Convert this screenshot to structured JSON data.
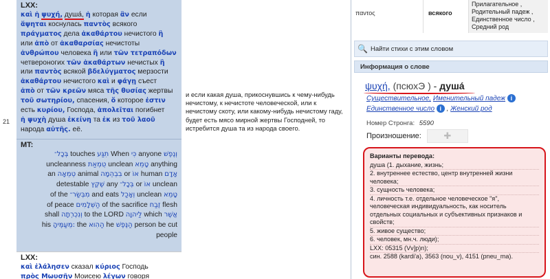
{
  "verse_number": "21",
  "lxx": {
    "label": "LXX:",
    "lines": [
      [
        {
          "g": "καὶ ἡ"
        },
        {
          "g": "ψυχή,",
          "u": true
        },
        {
          "r": "душа́,",
          "u": true
        },
        {
          "g": "ἡ"
        },
        {
          "r": "которая"
        },
        {
          "g": "ἂν"
        },
        {
          "r": "если"
        }
      ],
      [
        {
          "g": "ἅψηται"
        },
        {
          "r": "коснулась"
        },
        {
          "g": "παντὸς"
        },
        {
          "r": "всякого"
        }
      ],
      [
        {
          "g": "πράγματος"
        },
        {
          "r": "дела"
        },
        {
          "g": "ἀκαθάρτου"
        },
        {
          "r": "нечистого"
        },
        {
          "g": "ἢ"
        }
      ],
      [
        {
          "r": "или"
        },
        {
          "g": "ἀπὸ"
        },
        {
          "r": "от"
        },
        {
          "g": "ἀκαθαρσίας"
        },
        {
          "r": "нечистоты"
        }
      ],
      [
        {
          "g": "ἀνθρώπου"
        },
        {
          "r": "человека"
        },
        {
          "g": "ἢ"
        },
        {
          "r": "или"
        },
        {
          "g": "τῶν τετραπόδων"
        }
      ],
      [
        {
          "r": "четвероногих"
        },
        {
          "g": "τῶν ἀκαθάρτων"
        },
        {
          "r": "нечистых"
        },
        {
          "g": "ἢ"
        }
      ],
      [
        {
          "r": "или"
        },
        {
          "g": "παντὸς"
        },
        {
          "r": "всякой"
        },
        {
          "g": "βδελύγματος"
        },
        {
          "r": "мерзости"
        }
      ],
      [
        {
          "g": "ἀκαθάρτου"
        },
        {
          "r": "нечистого"
        },
        {
          "g": "καὶ"
        },
        {
          "r": "и"
        },
        {
          "g": "φάγῃ"
        },
        {
          "r": "съест"
        }
      ],
      [
        {
          "g": "ἀπὸ"
        },
        {
          "r": "от"
        },
        {
          "g": "τῶν κρεῶν"
        },
        {
          "r": "мяса"
        },
        {
          "g": "τῆς θυσίας"
        },
        {
          "r": "жертвы"
        }
      ],
      [
        {
          "g": "τοῦ σωτηρίου,"
        },
        {
          "r": "спасения,"
        },
        {
          "g": "ὅ"
        },
        {
          "r": "которое"
        },
        {
          "g": "ἐστιν"
        }
      ],
      [
        {
          "r": "есть"
        },
        {
          "g": "κυρίου,"
        },
        {
          "r": "Господа,"
        },
        {
          "g": "ἀπολεῖται"
        },
        {
          "r": "погибнет"
        }
      ],
      [
        {
          "g": "ἡ ψυχὴ"
        },
        {
          "r": "душа"
        },
        {
          "g": "ἐκείνη"
        },
        {
          "r": "та"
        },
        {
          "g": "ἐκ"
        },
        {
          "r": "из"
        },
        {
          "g": "τοῦ λαοῦ"
        }
      ],
      [
        {
          "r": "народа"
        },
        {
          "g": "αὐτῆς."
        },
        {
          "r": "её."
        }
      ]
    ]
  },
  "mt": {
    "label": "MT:",
    "lines": [
      [
        {
          "h": "בְּכָל־"
        },
        {
          "e": "touches"
        },
        {
          "h": "תִגַּע"
        },
        {
          "e": "When"
        },
        {
          "h": "כִּי"
        },
        {
          "e": "anyone"
        },
        {
          "h": "וְנֶפֶשׁ"
        }
      ],
      [
        {
          "e": "uncleanness"
        },
        {
          "h": "טֻמְאַת"
        },
        {
          "e": "unclean"
        },
        {
          "h": "טָמֵא"
        },
        {
          "e": "anything"
        }
      ],
      [
        {
          "e": "an"
        },
        {
          "h": "טְמֵאָה"
        },
        {
          "e": "animal"
        },
        {
          "h": "בִבְהֵמָה"
        },
        {
          "e": "or"
        },
        {
          "h": "אוֹ"
        },
        {
          "e": "human"
        },
        {
          "h": "אָדָם"
        }
      ],
      [
        {
          "e": "detestable"
        },
        {
          "h": "שֶׁקֶץ"
        },
        {
          "e": "any"
        },
        {
          "h": "בְּכָל־"
        },
        {
          "e": "or"
        },
        {
          "h": "אוֹ"
        },
        {
          "e": "unclean"
        }
      ],
      [
        {
          "e": "of the"
        },
        {
          "h": "מִבְּשַׂר־"
        },
        {
          "e": "and eats"
        },
        {
          "h": "וְאָכַל"
        },
        {
          "e": "unclean"
        },
        {
          "h": "טָמֵא"
        }
      ],
      [
        {
          "e": "of peace"
        },
        {
          "h": "הַשְּׁלָמִים"
        },
        {
          "e": "of the sacrifice"
        },
        {
          "h": "זֶבַח"
        },
        {
          "e": "flesh"
        }
      ],
      [
        {
          "e": "shall"
        },
        {
          "h": "וְנִכְרְתָה"
        },
        {
          "e": "to the LORD"
        },
        {
          "h": "לַיהוָה"
        },
        {
          "e": "which"
        },
        {
          "h": "אֲשֶׁר"
        }
      ],
      [
        {
          "e": "his"
        },
        {
          "h": "מֵעַמֶּיהָ:"
        },
        {
          "e": "the"
        },
        {
          "h": "הַהִוא"
        },
        {
          "e": "he"
        },
        {
          "h": "הַנֶּפֶשׁ"
        },
        {
          "e": "person"
        },
        {
          "e": "be cut"
        }
      ],
      [
        {
          "e": "people"
        }
      ]
    ]
  },
  "lxx2": {
    "label": "LXX:",
    "lines": [
      [
        {
          "g": "καὶ ἐλάλησεν"
        },
        {
          "r": "сказал"
        },
        {
          "g": "κύριος"
        },
        {
          "r": "Господь"
        }
      ],
      [
        {
          "g": "πρὸς Μωυσῆν"
        },
        {
          "r": "Моисею"
        },
        {
          "g": "λέγων"
        },
        {
          "r": "говоря"
        }
      ]
    ]
  },
  "translation": "и если какая душа, прикоснувшись к чему-нибудь нечистому, к нечистоте человеческой, или к нечистому скоту, или какому-нибудь нечистому гаду, будет есть мясо мирной жертвы Господней, то истребится душа та из народа своего.",
  "top_table": {
    "col1": "παντος",
    "col2": "всякого",
    "col3": [
      "Прилагательное ,",
      "Родительный падеж ,",
      "Единственное число ,",
      "Средний род"
    ]
  },
  "search_label": "Найти стихи с этим словом",
  "info_header": "Информация о слове",
  "word": {
    "lemma": "ψυχή,",
    "translit": "(псюхЭ )",
    "dash": "-",
    "russian": "душа́",
    "morph_line1": {
      "pos": "Существительное,",
      "case": "Именительный падеж"
    },
    "morph_line2": {
      "number": "Единственное число",
      "gender": "Женский род"
    },
    "strong_label": "Номер Стронга:",
    "strong_number": "5590",
    "pron_label": "Произношение:"
  },
  "variants": {
    "header": "Варианты перевода:",
    "lines": [
      "душа (1. дыхание, жизнь;",
      "2. внутреннее естество, центр внутренней жизни человека;",
      "3. сущность человека;",
      "4. личность т.е. отдельное человеческое \"я\", человеческая индивидуальность, как носитель отдельных социальных и субъективных признаков и свойств;",
      "5. живое существо;",
      "6. человек, мн.ч. люди);",
      "LXX: 05315 (Vv]p)n);",
      "син. 2588 (kardi'a), 3563 (nou_v), 4151 (pneu_ma)."
    ]
  },
  "colors": {
    "panel_bg": "#c5d4e7",
    "accent_blue": "#1b43b5",
    "highlight_red": "#d7141a",
    "variants_bg": "#fbe6e6"
  }
}
